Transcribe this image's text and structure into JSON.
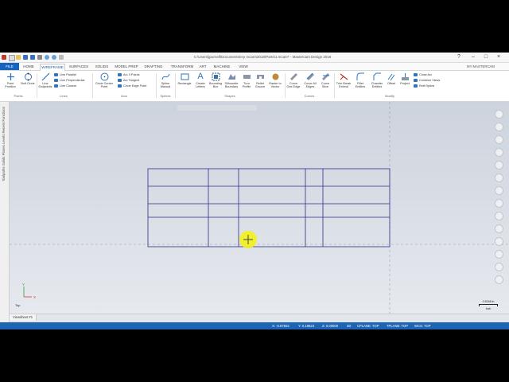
{
  "app": {
    "window_title": "C:\\Users\\jpurnell\\Documents\\my mcam\\2018\\Parts\\1.mcam* - Mastercam Design 2018",
    "file_tab": "FILE",
    "tabs": [
      "HOME",
      "WIREFRAME",
      "SURFACES",
      "SOLIDS",
      "MODEL PREP",
      "DRAFTING",
      "TRANSFORM",
      "ART",
      "MACHINE",
      "VIEW"
    ],
    "active_tab": "WIREFRAME",
    "account": "MY MASTERCAM"
  },
  "ribbon": {
    "points": {
      "point_position": "Point Position",
      "bolt_circle": "Bolt Circle",
      "group": "Points"
    },
    "lines": {
      "line_endpoints": "Line Endpoints",
      "line_parallel": "Line Parallel",
      "line_perpendicular": "Line Perpendicular",
      "line_closest": "Line Closest",
      "group": "Lines"
    },
    "arcs": {
      "circle_center_point": "Circle Center Point",
      "arc_3_points": "Arc 3 Points",
      "arc_tangent": "Arc Tangent",
      "circle_edge_point": "Circle Edge Point",
      "group": "Arcs"
    },
    "splines": {
      "spline_manual": "Spline Manual",
      "group": "Splines"
    },
    "shapes": {
      "rectangle": "Rectangle",
      "create_letters": "Create Letters",
      "bounding_box": "Bounding Box",
      "silhouette_boundary": "Silhouette Boundary",
      "turn_profile": "Turn Profile",
      "relief_groove": "Relief Groove",
      "raster_to_vector": "Raster to Vector",
      "group": "Shapes"
    },
    "curves": {
      "curve_one_edge": "Curve One Edge",
      "curve_all_edges": "Curve All Edges",
      "curve_slice": "Curve Slice",
      "group": "Curves"
    },
    "modify": {
      "trim_break_extend": "Trim Break Extend",
      "fillet_entities": "Fillet Entities",
      "chamfer_entities": "Chamfer Entities",
      "offset": "Offset",
      "project": "Project",
      "close_arc": "Close Arc",
      "combine_views": "Combine Views",
      "refit_spline": "Refit Spline",
      "group": "Modify"
    }
  },
  "manager_tabs": "Toolpaths  Solids  Planes  Levels  Recent Functions",
  "viewport": {
    "view_name": "Top",
    "axis_x": "X",
    "axis_y": "Y",
    "scale_value": "0.5248 in",
    "scale_unit": "Inch",
    "tab_label": "Viewsheet #1"
  },
  "status": {
    "x": "X:  -0.87502",
    "y": "Y:  0.19623",
    "z": "Z:  0.00000",
    "mode": "3D",
    "cplane": "CPLANE: TOP",
    "tplane": "TPLANE: TOP",
    "wcs": "WCS: TOP"
  },
  "colors": {
    "accent": "#1565c0",
    "wire": "#2b2f8a",
    "cursor": "#f4f11b",
    "status_bar": "#1e64b4"
  }
}
